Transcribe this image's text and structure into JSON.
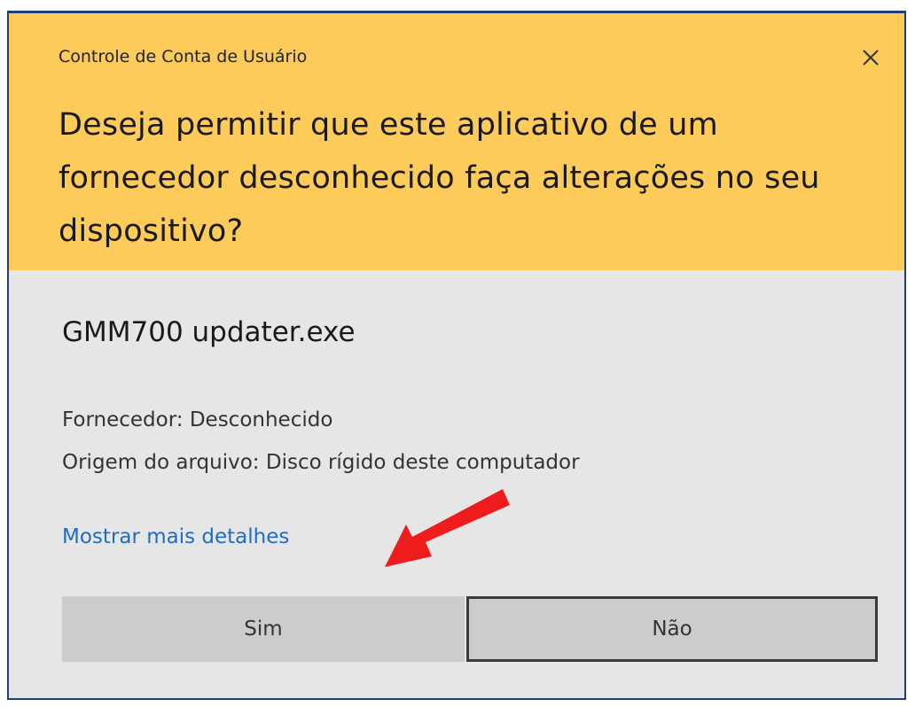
{
  "dialog": {
    "caption": "Controle de Conta de Usuário",
    "close_icon": "close-icon",
    "question": "Deseja permitir que este aplicativo de um fornecedor desconhecido faça alterações no seu dispositivo?",
    "app_name": "GMM700 updater.exe",
    "publisher": "Fornecedor: Desconhecido",
    "origin": "Origem do arquivo: Disco rígido deste computador",
    "details_link": "Mostrar mais detalhes",
    "buttons": {
      "yes": "Sim",
      "no": "Não"
    }
  },
  "annotation": {
    "arrow_icon": "red-arrow-icon",
    "arrow_color": "#ee1c1c"
  },
  "colors": {
    "header_bg": "#fdcb5a",
    "body_bg": "#e6e6e6",
    "link": "#1f6dc6",
    "button_bg": "#cccccc"
  }
}
